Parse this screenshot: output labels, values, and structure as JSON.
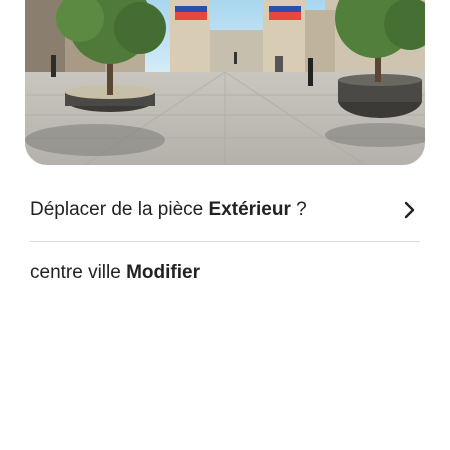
{
  "photo": {
    "alt_icon": "street-photo"
  },
  "move_row": {
    "prefix": "Déplacer de la pièce ",
    "room": "Extérieur",
    "suffix": " ?",
    "icon": "chevron-right-icon"
  },
  "location_row": {
    "place": "centre ville ",
    "edit_label": "Modifier"
  },
  "colors": {
    "text": "#222222",
    "divider": "#dddddd"
  }
}
